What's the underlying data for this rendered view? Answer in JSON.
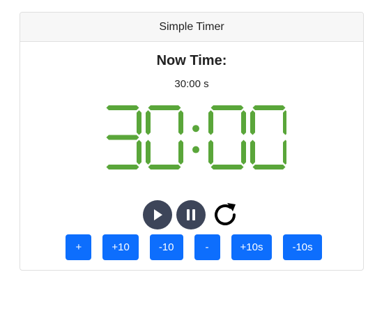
{
  "header": {
    "title": "Simple Timer"
  },
  "main": {
    "heading": "Now Time:",
    "time_text": "30:00 s",
    "display_digits": "30:00"
  },
  "controls": {
    "play_icon": "play-icon",
    "pause_icon": "pause-icon",
    "reset_icon": "refresh-icon"
  },
  "adjust_buttons": [
    "+",
    "+10",
    "-10",
    "-",
    "+10s",
    "-10s"
  ],
  "colors": {
    "digit": "#5aa63a",
    "button": "#0d6efd",
    "round_button": "#3d4559"
  }
}
